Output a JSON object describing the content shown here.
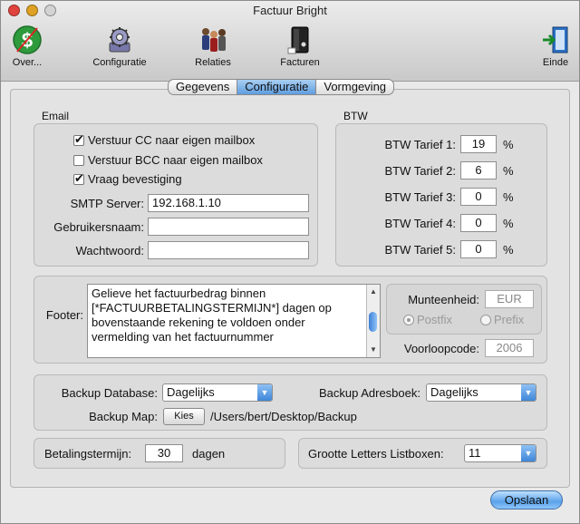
{
  "window": {
    "title": "Factuur Bright"
  },
  "toolbar": {
    "over": "Over...",
    "configuratie": "Configuratie",
    "relaties": "Relaties",
    "facturen": "Facturen",
    "einde": "Einde"
  },
  "tabs": [
    "Gegevens",
    "Configuratie",
    "Vormgeving"
  ],
  "email": {
    "title": "Email",
    "cc_label": "Verstuur CC naar eigen mailbox",
    "bcc_label": "Verstuur BCC naar eigen mailbox",
    "confirm_label": "Vraag bevestiging",
    "smtp_label": "SMTP Server:",
    "smtp_value": "192.168.1.10",
    "user_label": "Gebruikersnaam:",
    "user_value": "",
    "pass_label": "Wachtwoord:",
    "pass_value": ""
  },
  "btw": {
    "title": "BTW",
    "rates": [
      {
        "label": "BTW Tarief 1:",
        "value": "19"
      },
      {
        "label": "BTW Tarief 2:",
        "value": "6"
      },
      {
        "label": "BTW Tarief 3:",
        "value": "0"
      },
      {
        "label": "BTW Tarief 4:",
        "value": "0"
      },
      {
        "label": "BTW Tarief 5:",
        "value": "0"
      }
    ],
    "unit": "%"
  },
  "footer": {
    "label": "Footer:",
    "lines": [
      "Gelieve het factuurbedrag binnen",
      "[*FACTUURBETALINGSTERMIJN*] dagen op",
      "bovenstaande rekening te voldoen onder",
      "vermelding van het factuurnummer"
    ]
  },
  "currency": {
    "label": "Munteenheid:",
    "value": "EUR",
    "postfix": "Postfix",
    "prefix": "Prefix",
    "voorloop_label": "Voorloopcode:",
    "voorloop_value": "2006"
  },
  "backup": {
    "db_label": "Backup Database:",
    "db_value": "Dagelijks",
    "addr_label": "Backup Adresboek:",
    "addr_value": "Dagelijks",
    "map_label": "Backup Map:",
    "kies": "Kies",
    "path": "/Users/bert/Desktop/Backup"
  },
  "payment": {
    "label": "Betalingstermijn:",
    "value": "30",
    "unit": "dagen"
  },
  "fontsize": {
    "label": "Grootte Letters Listboxen:",
    "value": "11"
  },
  "save": "Opslaan"
}
